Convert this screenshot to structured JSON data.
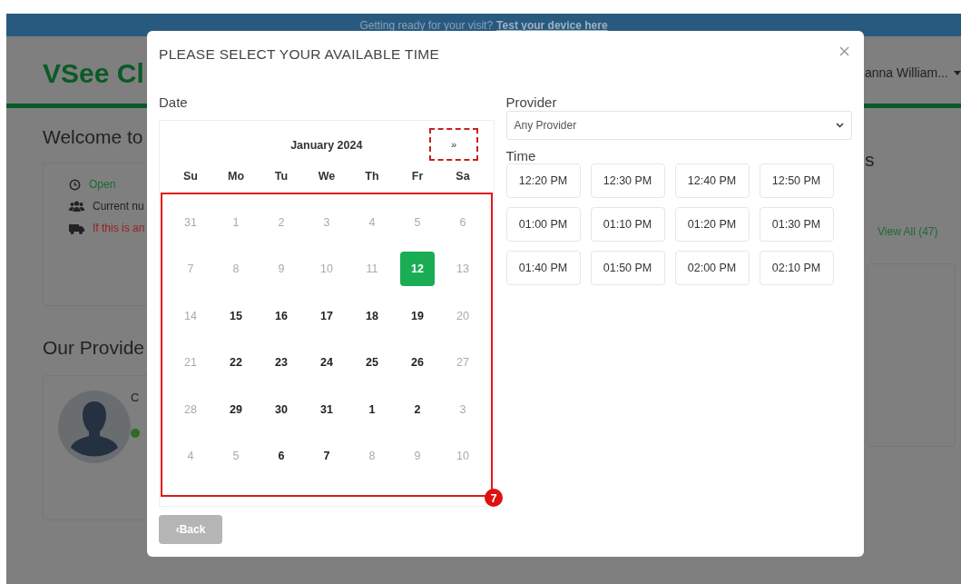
{
  "banner": {
    "text": "Getting ready for your visit?",
    "link": "Test your device here"
  },
  "background_page": {
    "logo": "VSee Cl",
    "user_menu": "anna William...",
    "welcome_heading": "Welcome to",
    "status_items": [
      {
        "kind": "clock",
        "text": "Open"
      },
      {
        "kind": "people",
        "text": "Current nu"
      },
      {
        "kind": "ambulance",
        "text": "If this is an"
      }
    ],
    "providers_heading": "Our Provide",
    "provider_name": "C",
    "right_heading": "s",
    "view_all_link": "View All (47)"
  },
  "modal": {
    "title": "PLEASE SELECT YOUR AVAILABLE TIME",
    "date_label": "Date",
    "month": "January 2024",
    "next_button": "»",
    "weekdays": [
      "Su",
      "Mo",
      "Tu",
      "We",
      "Th",
      "Fr",
      "Sa"
    ],
    "days": [
      {
        "label": "31",
        "available": false,
        "selected": false
      },
      {
        "label": "1",
        "available": false,
        "selected": false
      },
      {
        "label": "2",
        "available": false,
        "selected": false
      },
      {
        "label": "3",
        "available": false,
        "selected": false
      },
      {
        "label": "4",
        "available": false,
        "selected": false
      },
      {
        "label": "5",
        "available": false,
        "selected": false
      },
      {
        "label": "6",
        "available": false,
        "selected": false
      },
      {
        "label": "7",
        "available": false,
        "selected": false
      },
      {
        "label": "8",
        "available": false,
        "selected": false
      },
      {
        "label": "9",
        "available": false,
        "selected": false
      },
      {
        "label": "10",
        "available": false,
        "selected": false
      },
      {
        "label": "11",
        "available": false,
        "selected": false
      },
      {
        "label": "12",
        "available": true,
        "selected": true
      },
      {
        "label": "13",
        "available": false,
        "selected": false
      },
      {
        "label": "14",
        "available": false,
        "selected": false
      },
      {
        "label": "15",
        "available": true,
        "selected": false
      },
      {
        "label": "16",
        "available": true,
        "selected": false
      },
      {
        "label": "17",
        "available": true,
        "selected": false
      },
      {
        "label": "18",
        "available": true,
        "selected": false
      },
      {
        "label": "19",
        "available": true,
        "selected": false
      },
      {
        "label": "20",
        "available": false,
        "selected": false
      },
      {
        "label": "21",
        "available": false,
        "selected": false
      },
      {
        "label": "22",
        "available": true,
        "selected": false
      },
      {
        "label": "23",
        "available": true,
        "selected": false
      },
      {
        "label": "24",
        "available": true,
        "selected": false
      },
      {
        "label": "25",
        "available": true,
        "selected": false
      },
      {
        "label": "26",
        "available": true,
        "selected": false
      },
      {
        "label": "27",
        "available": false,
        "selected": false
      },
      {
        "label": "28",
        "available": false,
        "selected": false
      },
      {
        "label": "29",
        "available": true,
        "selected": false
      },
      {
        "label": "30",
        "available": true,
        "selected": false
      },
      {
        "label": "31",
        "available": true,
        "selected": false
      },
      {
        "label": "1",
        "available": true,
        "selected": false
      },
      {
        "label": "2",
        "available": true,
        "selected": false
      },
      {
        "label": "3",
        "available": false,
        "selected": false
      },
      {
        "label": "4",
        "available": false,
        "selected": false
      },
      {
        "label": "5",
        "available": false,
        "selected": false
      },
      {
        "label": "6",
        "available": true,
        "selected": false
      },
      {
        "label": "7",
        "available": true,
        "selected": false
      },
      {
        "label": "8",
        "available": false,
        "selected": false
      },
      {
        "label": "9",
        "available": false,
        "selected": false
      },
      {
        "label": "10",
        "available": false,
        "selected": false
      }
    ],
    "provider_label": "Provider",
    "provider_select": "Any Provider",
    "time_label": "Time",
    "times": [
      "12:20 PM",
      "12:30 PM",
      "12:40 PM",
      "12:50 PM",
      "01:00 PM",
      "01:10 PM",
      "01:20 PM",
      "01:30 PM",
      "01:40 PM",
      "01:50 PM",
      "02:00 PM",
      "02:10 PM"
    ],
    "back_button": "‹Back"
  },
  "annotation": {
    "badge": "7"
  }
}
